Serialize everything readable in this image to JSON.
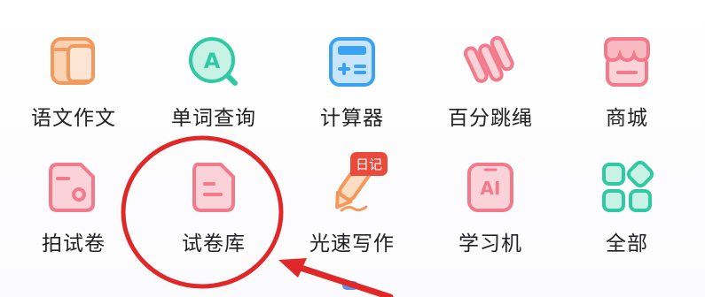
{
  "grid": {
    "row1": [
      {
        "label": "语文作文",
        "icon": "notebook-icon"
      },
      {
        "label": "单词查询",
        "icon": "word-search-icon"
      },
      {
        "label": "计算器",
        "icon": "calculator-icon"
      },
      {
        "label": "百分跳绳",
        "icon": "jump-rope-icon"
      },
      {
        "label": "商城",
        "icon": "shop-icon"
      }
    ],
    "row2": [
      {
        "label": "拍试卷",
        "icon": "scan-paper-icon"
      },
      {
        "label": "试卷库",
        "icon": "paper-library-icon"
      },
      {
        "label": "光速写作",
        "icon": "writing-icon",
        "badge": "日记"
      },
      {
        "label": "学习机",
        "icon": "ai-machine-icon"
      },
      {
        "label": "全部",
        "icon": "all-apps-icon"
      }
    ]
  },
  "colors": {
    "orange": "#f5a06a",
    "teal": "#34cfae",
    "blue": "#3aa2ef",
    "pink": "#f27a8a",
    "annotation_red": "#e02828",
    "badge_red": "#e94a3a"
  }
}
